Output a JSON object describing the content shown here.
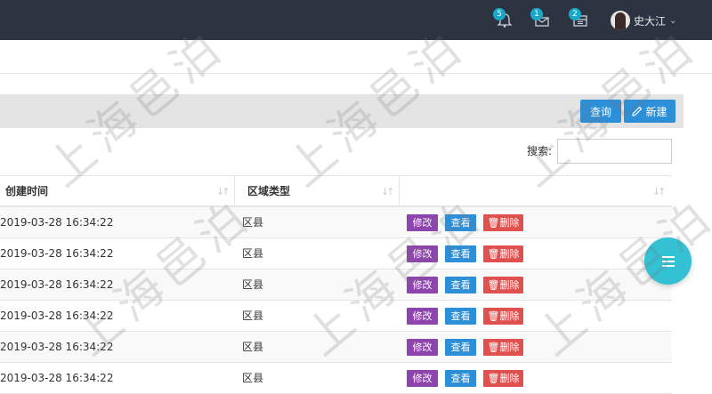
{
  "header": {
    "notifications": [
      {
        "icon": "bell-icon",
        "count": "5"
      },
      {
        "icon": "envelope-icon",
        "count": "1"
      },
      {
        "icon": "calendar-icon",
        "count": "2"
      }
    ],
    "user": {
      "name": "史大江",
      "caret": "⌄"
    }
  },
  "toolbar": {
    "query_label": "查询",
    "new_label": "新建"
  },
  "search": {
    "label": "搜索:",
    "value": ""
  },
  "table": {
    "columns": {
      "created": "创建时间",
      "type": "区域类型",
      "sort_glyph": "↓↑"
    },
    "rows": [
      {
        "created": "2019-03-28 16:34:22",
        "type": "区县"
      },
      {
        "created": "2019-03-28 16:34:22",
        "type": "区县"
      },
      {
        "created": "2019-03-28 16:34:22",
        "type": "区县"
      },
      {
        "created": "2019-03-28 16:34:22",
        "type": "区县"
      },
      {
        "created": "2019-03-28 16:34:22",
        "type": "区县"
      },
      {
        "created": "2019-03-28 16:34:22",
        "type": "区县"
      }
    ],
    "actions": {
      "edit": "修改",
      "view": "查看",
      "delete": "删除"
    }
  },
  "fab": {
    "icon": "menu-icon"
  },
  "watermark": "上海邑泊",
  "colors": {
    "topbar": "#2b3440",
    "primary": "#2d8fd8",
    "edit": "#8e44ad",
    "delete": "#e0504f",
    "fab": "#34c1d3"
  }
}
